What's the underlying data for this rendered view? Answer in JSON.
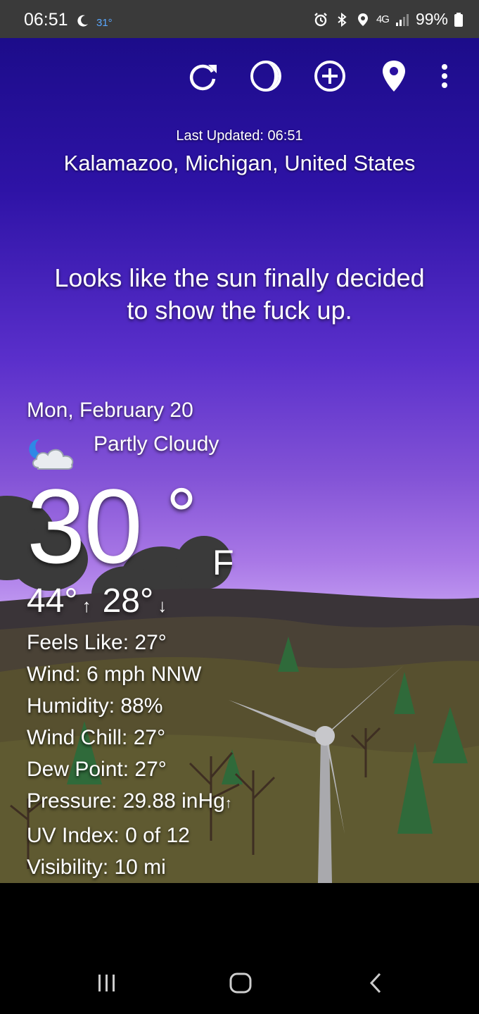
{
  "status_bar": {
    "time": "06:51",
    "weather_temp": "31°",
    "network": "4G",
    "battery": "99%",
    "icons": [
      "moon-icon",
      "alarm-icon",
      "bluetooth-icon",
      "location-icon",
      "signal-icon",
      "battery-icon"
    ]
  },
  "toolbar": {
    "icons": [
      "refresh-icon",
      "theme-icon",
      "add-location-icon",
      "location-pin-icon",
      "more-vert-icon"
    ]
  },
  "header": {
    "last_updated": "Last Updated: 06:51",
    "location": "Kalamazoo, Michigan, United States"
  },
  "quip": {
    "line1": "Looks like the sun finally decided",
    "line2": "to show the fuck up."
  },
  "current": {
    "date": "Mon, February 20",
    "condition": "Partly Cloudy",
    "condition_icon": "partly-cloudy-night-icon",
    "temp": "30",
    "degree": "°",
    "unit": "F",
    "high": "44°",
    "low": "28°",
    "high_arrow": "↑",
    "low_arrow": "↓"
  },
  "details": {
    "feels_like": "Feels Like:  27°",
    "wind": "Wind:  6 mph NNW",
    "humidity": "Humidity:  88%",
    "wind_chill": "Wind Chill:  27°",
    "dew_point": "Dew Point:  27°",
    "pressure": "Pressure:  29.88 inHg",
    "pressure_trend": "↑",
    "uv_index": "UV Index:  0 of 12",
    "visibility": "Visibility:  10 mi"
  },
  "nav": {
    "icons": [
      "recents-icon",
      "home-icon",
      "back-icon"
    ]
  },
  "colors": {
    "sky_top": "#1c0c8a",
    "sky_mid": "#5a2fcb",
    "sky_horizon": "#c29cf2",
    "status_bar": "#3a3a3a",
    "temp_badge": "#5aa8ff"
  }
}
